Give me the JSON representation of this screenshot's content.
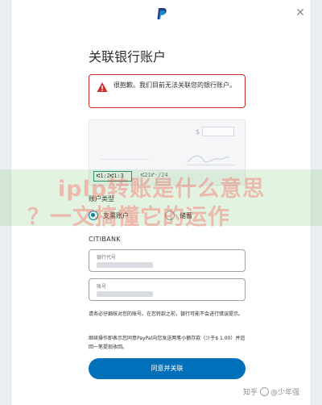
{
  "header": {
    "logo_icon": "paypal-logo-icon",
    "close_icon": "close-icon",
    "close_symbol": "✕"
  },
  "title": "关联银行账户",
  "error": {
    "icon": "warning-triangle-icon",
    "message": "很抱歉。我们目前无法关联您的银行账户。",
    "color": "#c9302c"
  },
  "check": {
    "dollar": "$",
    "routing_number": "⑆1:2⑆1:3",
    "account_number": "⑆21⑈·/24"
  },
  "account_type": {
    "label": "账户类型",
    "options": [
      {
        "label": "支票账户",
        "selected": true
      },
      {
        "label": "储蓄",
        "selected": false
      }
    ]
  },
  "bank_name": "CITIBANK",
  "fields": {
    "routing": {
      "label": "银行代号"
    },
    "account": {
      "label": "账号"
    }
  },
  "notes": {
    "note1": "请务必仔细核对您的账号。在您转款之前，银行可能不会进行错误提示。",
    "note2": "继续操作即表示您同意PayPal向您发送两笔小额存款（少于$ 1.00）并追回一笔提现收回。"
  },
  "agree_button": "同意并关联",
  "watermark": {
    "line1": "iplp转账是什么意思",
    "line2": "？一文搞懂它的运作"
  },
  "credit": {
    "site": "知乎",
    "user": "@少年强"
  },
  "colors": {
    "brand_blue": "#0070ba",
    "error_red": "#c9302c",
    "routing_highlight": "#1f8a6a"
  }
}
